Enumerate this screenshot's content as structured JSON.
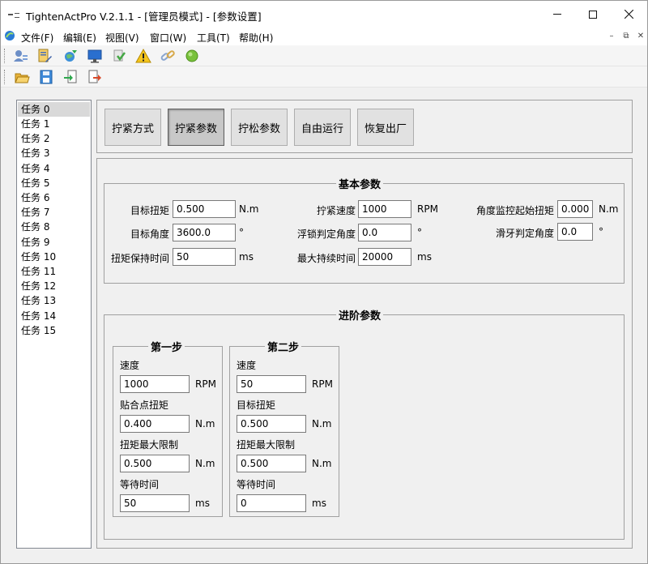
{
  "window": {
    "title": "TightenActPro V.2.1.1 - [管理员模式] - [参数设置]"
  },
  "menu": {
    "items": [
      "文件(F)",
      "编辑(E)",
      "视图(V)",
      "窗口(W)",
      "工具(T)",
      "帮助(H)"
    ],
    "mdi_controls": [
      "–",
      "⧉",
      "✕"
    ]
  },
  "toolbar": {
    "row1_icons": [
      "user-icon",
      "document-pen-icon",
      "globe-refresh-icon",
      "monitor-icon",
      "download-check-icon",
      "warning-icon",
      "link-icon",
      "green-circle-icon"
    ],
    "row2_icons": [
      "open-folder-icon",
      "save-icon",
      "import-icon",
      "export-icon"
    ]
  },
  "tasks": {
    "items": [
      "任务 0",
      "任务 1",
      "任务 2",
      "任务 3",
      "任务 4",
      "任务 5",
      "任务 6",
      "任务 7",
      "任务 8",
      "任务 9",
      "任务 10",
      "任务 11",
      "任务 12",
      "任务 13",
      "任务 14",
      "任务 15"
    ],
    "selected": "任务 0"
  },
  "tabs": {
    "items": [
      "拧紧方式",
      "拧紧参数",
      "拧松参数",
      "自由运行",
      "恢复出厂"
    ],
    "active": "拧紧参数"
  },
  "basic": {
    "title": "基本参数",
    "target_torque": {
      "label": "目标扭矩",
      "value": "0.500",
      "unit": "N.m"
    },
    "target_angle": {
      "label": "目标角度",
      "value": "3600.0",
      "unit": "°"
    },
    "torque_hold_time": {
      "label": "扭矩保持时间",
      "value": "50",
      "unit": "ms"
    },
    "tighten_speed": {
      "label": "拧紧速度",
      "value": "1000",
      "unit": "RPM"
    },
    "float_lock_angle": {
      "label": "浮锁判定角度",
      "value": "0.0",
      "unit": "°"
    },
    "max_duration": {
      "label": "最大持续时间",
      "value": "20000",
      "unit": "ms"
    },
    "angle_monitor_start_torque": {
      "label": "角度监控起始扭矩",
      "value": "0.000",
      "unit": "N.m"
    },
    "slip_angle": {
      "label": "滑牙判定角度",
      "value": "0.0",
      "unit": "°"
    }
  },
  "advanced": {
    "title": "进阶参数",
    "step1": {
      "title": "第一步",
      "speed": {
        "label": "速度",
        "value": "1000",
        "unit": "RPM"
      },
      "fit_torque": {
        "label": "贴合点扭矩",
        "value": "0.400",
        "unit": "N.m"
      },
      "torque_limit": {
        "label": "扭矩最大限制",
        "value": "0.500",
        "unit": "N.m"
      },
      "wait_time": {
        "label": "等待时间",
        "value": "50",
        "unit": "ms"
      }
    },
    "step2": {
      "title": "第二步",
      "speed": {
        "label": "速度",
        "value": "50",
        "unit": "RPM"
      },
      "target_torque": {
        "label": "目标扭矩",
        "value": "0.500",
        "unit": "N.m"
      },
      "torque_limit": {
        "label": "扭矩最大限制",
        "value": "0.500",
        "unit": "N.m"
      },
      "wait_time": {
        "label": "等待时间",
        "value": "0",
        "unit": "ms"
      }
    }
  }
}
